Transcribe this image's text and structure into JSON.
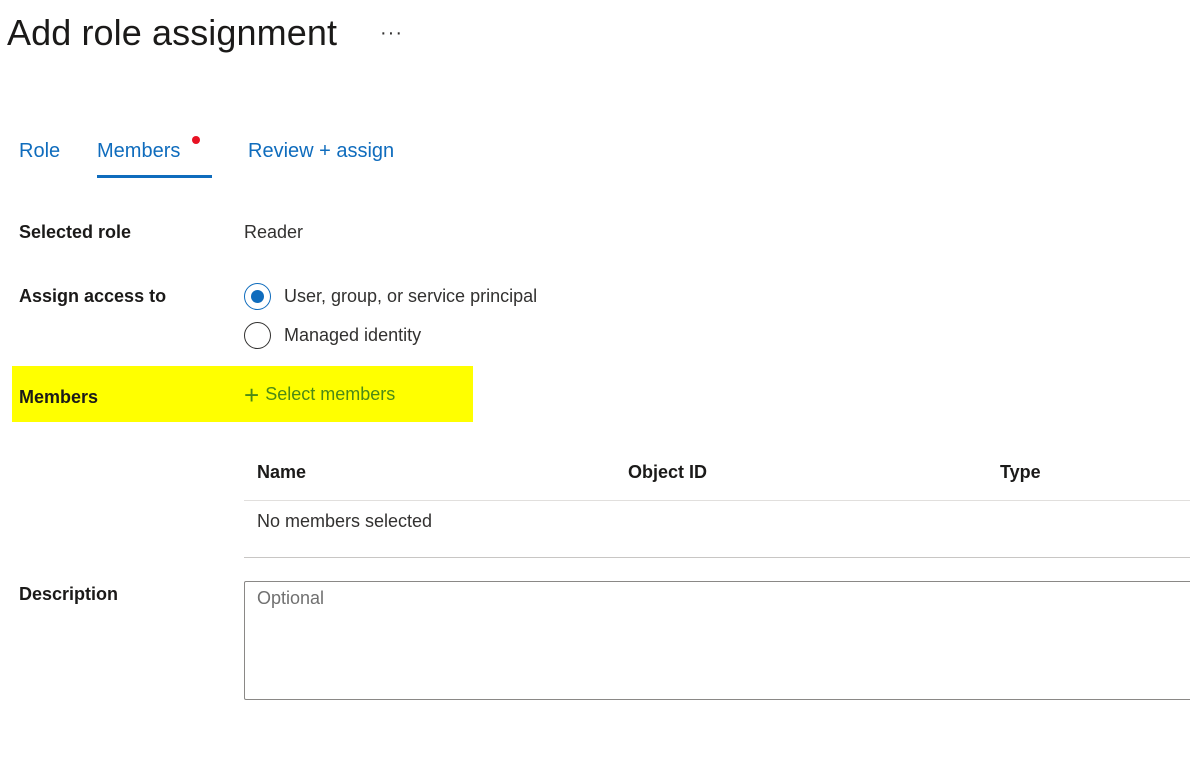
{
  "header": {
    "title": "Add role assignment",
    "more_label": "···"
  },
  "tabs": [
    {
      "label": "Role"
    },
    {
      "label": "Members"
    },
    {
      "label": "Review + assign"
    }
  ],
  "form": {
    "selected_role_label": "Selected role",
    "selected_role_value": "Reader",
    "assign_access_label": "Assign access to",
    "assign_options": [
      {
        "label": "User, group, or service principal",
        "checked": true
      },
      {
        "label": "Managed identity",
        "checked": false
      }
    ],
    "members_label": "Members",
    "select_members_label": "Select members",
    "description_label": "Description",
    "description_placeholder": "Optional",
    "description_value": ""
  },
  "members_table": {
    "columns": [
      "Name",
      "Object ID",
      "Type"
    ],
    "empty_text": "No members selected"
  },
  "colors": {
    "accent": "#0f6cbd",
    "highlight": "#ffff00",
    "link_green": "#4c8a16",
    "dot_red": "#e81123"
  }
}
